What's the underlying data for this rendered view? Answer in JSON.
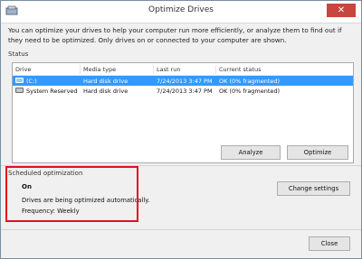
{
  "window": {
    "title": "Optimize Drives"
  },
  "intro": "You can optimize your drives to help your computer run more efficiently, or analyze them to find out if they need to be optimized. Only drives on or connected to your computer are shown.",
  "status": {
    "label": "Status",
    "columns": [
      "Drive",
      "Media type",
      "Last run",
      "Current status"
    ],
    "rows": [
      {
        "drive": "(C:)",
        "media": "Hard disk drive",
        "last_run": "7/24/2013 3:47 PM",
        "status": "OK (0% fragmented)",
        "selected": true
      },
      {
        "drive": "System Reserved",
        "media": "Hard disk drive",
        "last_run": "7/24/2013 3:47 PM",
        "status": "OK (0% fragmented)",
        "selected": false
      }
    ]
  },
  "buttons": {
    "analyze": "Analyze",
    "optimize": "Optimize",
    "change_settings": "Change settings",
    "close": "Close"
  },
  "schedule": {
    "label": "Scheduled optimization",
    "state": "On",
    "description": "Drives are being optimized automatically.",
    "frequency": "Frequency: Weekly"
  },
  "colors": {
    "selection": "#3399ff",
    "highlight_box": "#e3101f",
    "close_button": "#c7463d"
  }
}
